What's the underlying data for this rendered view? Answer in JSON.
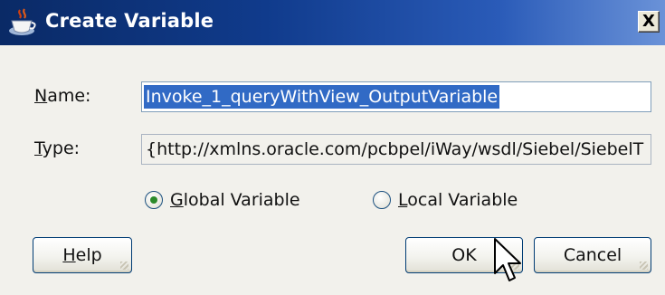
{
  "dialog": {
    "title": "Create Variable",
    "close_glyph": "X",
    "icon": "coffee-cup-icon"
  },
  "name_field": {
    "label_mnemonic": "N",
    "label_rest": "ame:",
    "value": "Invoke_1_queryWithView_OutputVariable"
  },
  "type_field": {
    "label_mnemonic": "T",
    "label_rest": "ype:",
    "value": "{http://xmlns.oracle.com/pcbpel/iWay/wsdl/Siebel/SiebelT"
  },
  "scope": {
    "global": {
      "mnemonic": "G",
      "rest": "lobal Variable",
      "checked": true
    },
    "local": {
      "mnemonic": "L",
      "rest": "ocal Variable",
      "checked": false
    }
  },
  "buttons": {
    "help_mnemonic": "H",
    "help_rest": "elp",
    "ok": "OK",
    "cancel": "Cancel"
  },
  "colors": {
    "title_bar_start": "#0a2a66",
    "title_bar_end": "#6a92d8",
    "selection": "#316ac5",
    "dialog_bg": "#f2f1ec"
  }
}
